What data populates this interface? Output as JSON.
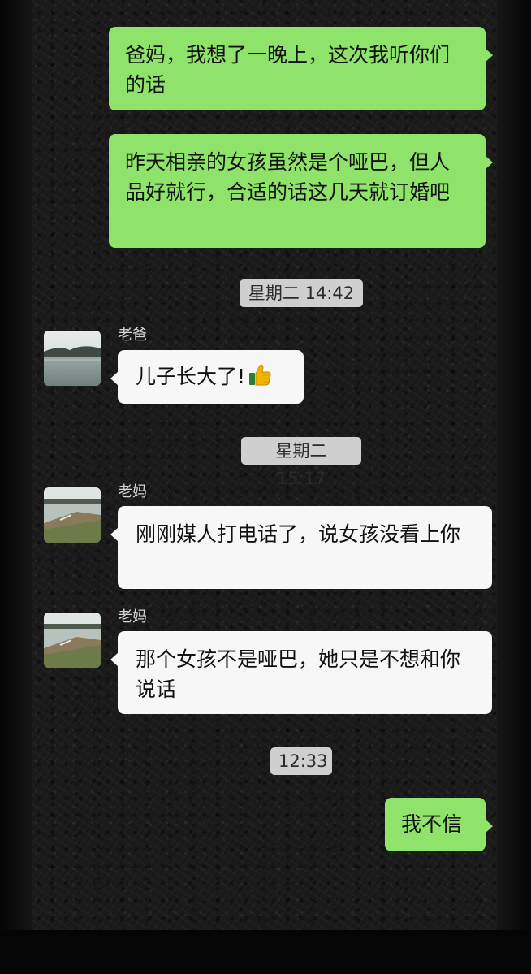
{
  "messages": [
    {
      "direction": "outgoing",
      "text": "爸妈，我想了一晚上，这次我听你们的话"
    },
    {
      "direction": "outgoing",
      "text": "昨天相亲的女孩虽然是个哑巴，但人品好就行，合适的话这几天就订婚吧"
    },
    {
      "type": "timestamp",
      "text": "星期二 14:42"
    },
    {
      "direction": "incoming",
      "sender": "老爸",
      "text": "儿子长大了!",
      "emoji": "thumbs-up-icon"
    },
    {
      "type": "timestamp",
      "text": "星期二 15:17"
    },
    {
      "direction": "incoming",
      "sender": "老妈",
      "text": "刚刚媒人打电话了，说女孩没看上你"
    },
    {
      "direction": "incoming",
      "sender": "老妈",
      "text": "那个女孩不是哑巴，她只是不想和你说话"
    },
    {
      "type": "timestamp",
      "text": "12:33"
    },
    {
      "direction": "outgoing",
      "text": "我不信"
    }
  ],
  "colors": {
    "outgoing_bubble": "#8fe26a",
    "incoming_bubble": "#f7f7f7",
    "timestamp_bg": "#cfcfcf",
    "chat_background": "#1b1b1b"
  },
  "avatars": {
    "dad": "lake-landscape-avatar",
    "mom": "riverbank-landscape-avatar"
  }
}
